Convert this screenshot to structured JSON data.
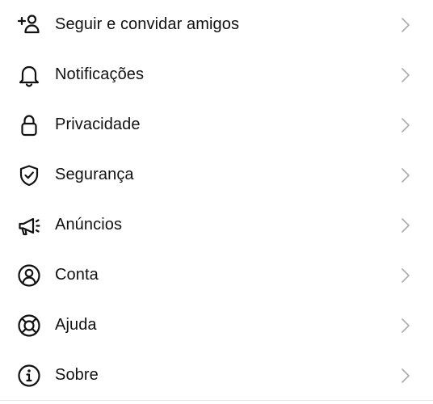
{
  "colors": {
    "text": "#111111",
    "icon": "#111111",
    "chevron": "#b0b0b0",
    "divider": "#e6e6e6",
    "background": "#ffffff"
  },
  "menu": {
    "items": [
      {
        "label": "Seguir e convidar amigos",
        "icon": "add-person-icon"
      },
      {
        "label": "Notificações",
        "icon": "bell-icon"
      },
      {
        "label": "Privacidade",
        "icon": "lock-icon"
      },
      {
        "label": "Segurança",
        "icon": "shield-check-icon"
      },
      {
        "label": "Anúncios",
        "icon": "megaphone-icon"
      },
      {
        "label": "Conta",
        "icon": "account-circle-icon"
      },
      {
        "label": "Ajuda",
        "icon": "lifebuoy-icon"
      },
      {
        "label": "Sobre",
        "icon": "info-icon"
      }
    ]
  }
}
